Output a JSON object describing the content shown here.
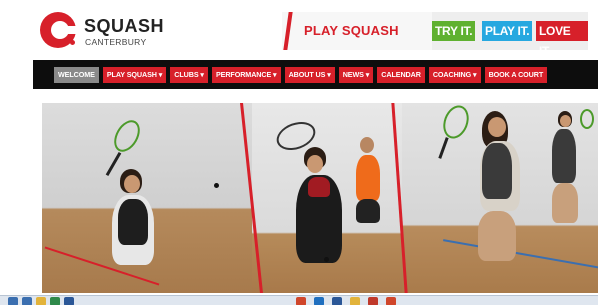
{
  "header": {
    "logo_title": "SQUASH",
    "logo_subtitle": "CANTERBURY"
  },
  "promo": {
    "main": "PLAY SQUASH",
    "tags": [
      "TRY IT.",
      "PLAY IT.",
      "LOVE IT."
    ]
  },
  "nav": {
    "items": [
      {
        "label": "WELCOME",
        "active": true
      },
      {
        "label": "PLAY SQUASH ▾",
        "active": false
      },
      {
        "label": "CLUBS ▾",
        "active": false
      },
      {
        "label": "PERFORMANCE ▾",
        "active": false
      },
      {
        "label": "ABOUT US ▾",
        "active": false
      },
      {
        "label": "NEWS ▾",
        "active": false
      },
      {
        "label": "CALENDAR",
        "active": false
      },
      {
        "label": "COACHING ▾",
        "active": false
      },
      {
        "label": "BOOK A COURT",
        "active": false
      }
    ]
  },
  "colors": {
    "brand_red": "#d7202a",
    "nav_bg": "#0d0d0d",
    "active_nav": "#8a8a8a",
    "tag_green": "#5fb130",
    "tag_blue": "#26a8e0"
  },
  "taskbar": {
    "icons": [
      "start-icon",
      "chrome-icon",
      "folder-icon",
      "excel-icon",
      "word-icon",
      "chrome-icon",
      "outlook-icon",
      "word-icon",
      "folder-icon",
      "paint-icon",
      "chrome-icon"
    ]
  }
}
